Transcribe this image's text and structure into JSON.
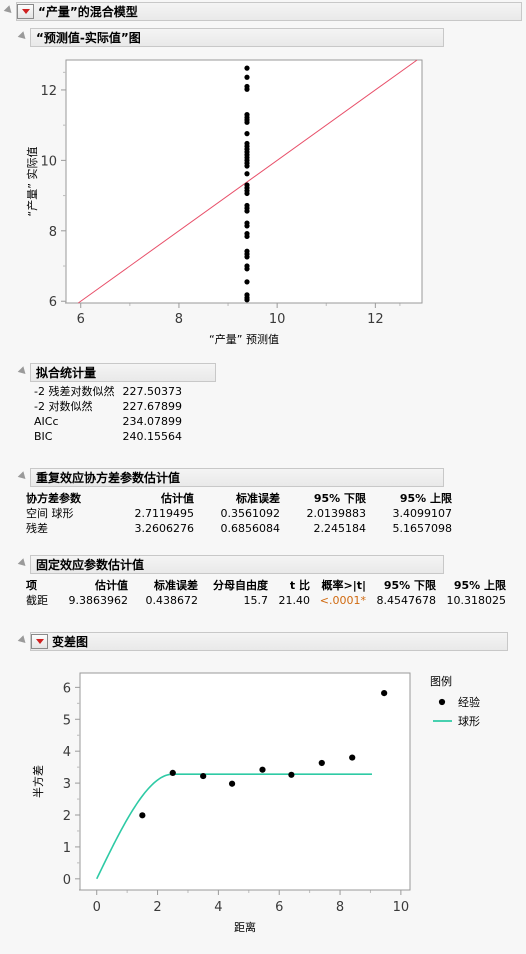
{
  "window": {
    "title": "“产量”的混合模型"
  },
  "sections": {
    "actual_by_predicted": {
      "title": "“预测值-实际值”图"
    },
    "fit_statistics": {
      "title": "拟合统计量",
      "rows": [
        {
          "label": "-2 残差对数似然",
          "value": "227.50373"
        },
        {
          "label": "-2 对数似然",
          "value": "227.67899"
        },
        {
          "label": "AICc",
          "value": "234.07899"
        },
        {
          "label": "BIC",
          "value": "240.15564"
        }
      ]
    },
    "repeated_covariance": {
      "title": "重复效应协方差参数估计值",
      "headers": [
        "协方差参数",
        "估计值",
        "标准误差",
        "95% 下限",
        "95% 上限"
      ],
      "rows": [
        [
          "空间 球形",
          "2.7119495",
          "0.3561092",
          "2.0139883",
          "3.4099107"
        ],
        [
          "残差",
          "3.2606276",
          "0.6856084",
          "2.245184",
          "5.1657098"
        ]
      ]
    },
    "fixed_effects": {
      "title": "固定效应参数估计值",
      "headers": [
        "项",
        "估计值",
        "标准误差",
        "分母自由度",
        "t 比",
        "概率>|t|",
        "95% 下限",
        "95% 上限"
      ],
      "rows": [
        [
          "截距",
          "9.3863962",
          "0.438672",
          "15.7",
          "21.40",
          "<.0001*",
          "8.4547678",
          "10.318025"
        ]
      ]
    },
    "variogram": {
      "title": "变差图"
    }
  },
  "chart_data": [
    {
      "type": "scatter",
      "name": "actual-by-predicted-plot",
      "title": "“预测值-实际值”图",
      "xlabel": "“产量” 预测值",
      "ylabel": "“产量” 实际值",
      "xlim": [
        5.7,
        12.95
      ],
      "ylim": [
        5.95,
        12.85
      ],
      "xticks": [
        6,
        8,
        10,
        12
      ],
      "yticks": [
        6,
        8,
        10,
        12
      ],
      "grid": false,
      "reference_line": {
        "label": "y = x",
        "color": "#e8506a",
        "slope": 1,
        "intercept": 0
      },
      "points": [
        {
          "x": 9.386,
          "y": 12.62
        },
        {
          "x": 9.386,
          "y": 12.36
        },
        {
          "x": 9.386,
          "y": 12.1
        },
        {
          "x": 9.386,
          "y": 12.02
        },
        {
          "x": 9.386,
          "y": 11.3
        },
        {
          "x": 9.386,
          "y": 11.22
        },
        {
          "x": 9.386,
          "y": 11.15
        },
        {
          "x": 9.386,
          "y": 11.08
        },
        {
          "x": 9.386,
          "y": 10.76
        },
        {
          "x": 9.386,
          "y": 10.48
        },
        {
          "x": 9.386,
          "y": 10.4
        },
        {
          "x": 9.386,
          "y": 10.32
        },
        {
          "x": 9.386,
          "y": 10.24
        },
        {
          "x": 9.386,
          "y": 10.16
        },
        {
          "x": 9.386,
          "y": 10.08
        },
        {
          "x": 9.386,
          "y": 10.0
        },
        {
          "x": 9.386,
          "y": 9.92
        },
        {
          "x": 9.386,
          "y": 9.84
        },
        {
          "x": 9.386,
          "y": 9.62
        },
        {
          "x": 9.386,
          "y": 9.3
        },
        {
          "x": 9.386,
          "y": 9.22
        },
        {
          "x": 9.386,
          "y": 9.14
        },
        {
          "x": 9.386,
          "y": 9.06
        },
        {
          "x": 9.386,
          "y": 8.72
        },
        {
          "x": 9.386,
          "y": 8.64
        },
        {
          "x": 9.386,
          "y": 8.56
        },
        {
          "x": 9.386,
          "y": 8.22
        },
        {
          "x": 9.386,
          "y": 8.14
        },
        {
          "x": 9.386,
          "y": 7.92
        },
        {
          "x": 9.386,
          "y": 7.84
        },
        {
          "x": 9.386,
          "y": 7.42
        },
        {
          "x": 9.386,
          "y": 7.34
        },
        {
          "x": 9.386,
          "y": 7.26
        },
        {
          "x": 9.386,
          "y": 7.0
        },
        {
          "x": 9.386,
          "y": 6.92
        },
        {
          "x": 9.386,
          "y": 6.55
        },
        {
          "x": 9.386,
          "y": 6.18
        },
        {
          "x": 9.386,
          "y": 6.1
        },
        {
          "x": 9.386,
          "y": 6.04
        }
      ]
    },
    {
      "type": "scatter",
      "name": "variogram-plot",
      "title": "变差图",
      "xlabel": "距离",
      "ylabel": "半方差",
      "xlim": [
        -0.55,
        10.3
      ],
      "ylim": [
        -0.35,
        6.45
      ],
      "xticks": [
        0,
        2,
        4,
        6,
        8,
        10
      ],
      "yticks": [
        0,
        1,
        2,
        3,
        4,
        5,
        6
      ],
      "grid": false,
      "legend": {
        "title": "图例",
        "position": "right",
        "entries": [
          {
            "label": "经验",
            "marker": "dot",
            "color": "#000000"
          },
          {
            "label": "球形",
            "marker": "line",
            "color": "#2ecaa5"
          }
        ]
      },
      "series": [
        {
          "name": "经验",
          "marker": "dot",
          "color": "#000000",
          "points": [
            {
              "x": 1.5,
              "y": 1.99
            },
            {
              "x": 2.5,
              "y": 3.32
            },
            {
              "x": 3.5,
              "y": 3.22
            },
            {
              "x": 4.45,
              "y": 2.98
            },
            {
              "x": 5.45,
              "y": 3.42
            },
            {
              "x": 6.4,
              "y": 3.26
            },
            {
              "x": 7.4,
              "y": 3.63
            },
            {
              "x": 8.4,
              "y": 3.8
            },
            {
              "x": 9.45,
              "y": 5.82
            }
          ]
        },
        {
          "name": "球形",
          "marker": "line",
          "color": "#2ecaa5",
          "model": "spherical",
          "sill": 3.28,
          "range": 2.5,
          "nugget": 0.0,
          "x_end": 9.05
        }
      ]
    }
  ]
}
